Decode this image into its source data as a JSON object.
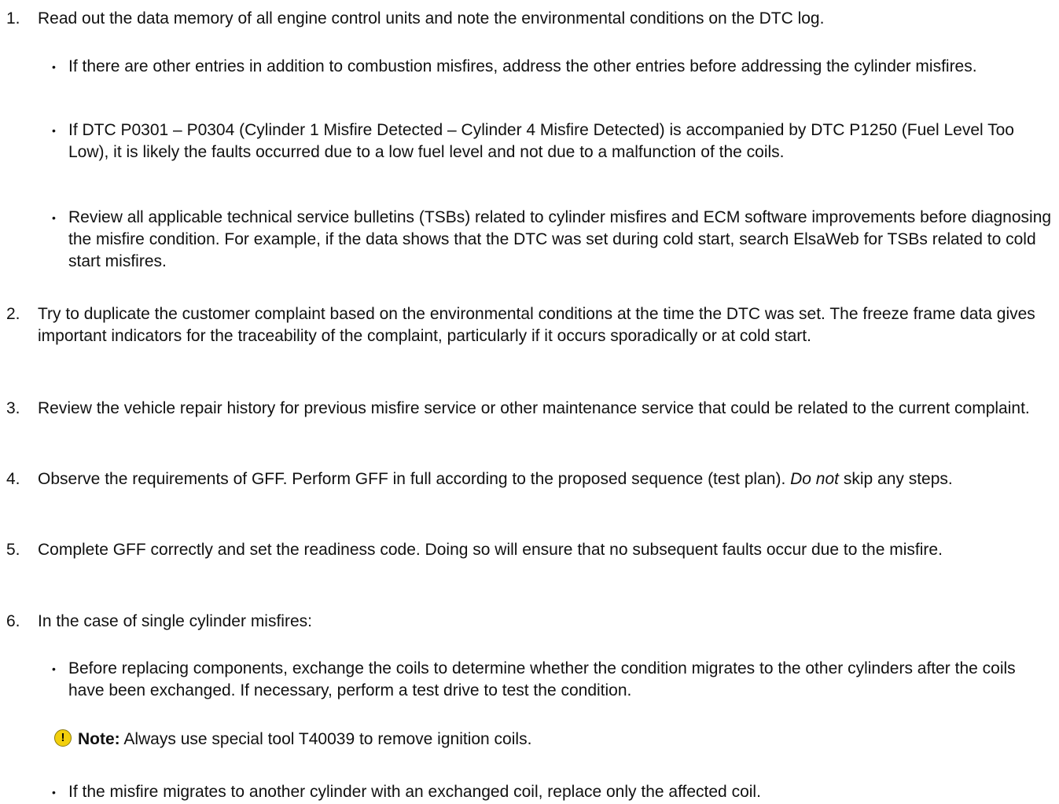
{
  "steps": [
    {
      "num": "1.",
      "text": "Read out the data memory of all engine control units and note the environmental conditions on the DTC log."
    },
    {
      "num": "2.",
      "text": "Try to duplicate the customer complaint based on the environmental conditions at the time the DTC was set. The freeze frame data gives important indicators for the traceability of the complaint, particularly if it occurs sporadically or at cold start."
    },
    {
      "num": "3.",
      "text": "Review the vehicle repair history for previous misfire service or other maintenance service that could be related to the current complaint."
    },
    {
      "num": "4.",
      "text_before": "Observe the requirements of GFF. Perform GFF in full according to the proposed sequence (test plan). ",
      "text_italic": "Do not",
      "text_after": " skip any steps."
    },
    {
      "num": "5.",
      "text": "Complete GFF correctly and set the readiness code. Doing so will ensure that no subsequent faults occur due to the misfire."
    },
    {
      "num": "6.",
      "text": "In the case of single cylinder misfires:"
    }
  ],
  "bullets_step1": [
    "If there are other entries in addition to combustion misfires, address the other entries before addressing the cylinder misfires.",
    "If DTC P0301 – P0304 (Cylinder 1 Misfire Detected – Cylinder 4 Misfire Detected) is accompanied by DTC P1250 (Fuel Level Too Low), it is likely the faults occurred due to a low fuel level and not due to a malfunction of the coils.",
    "Review all applicable technical service bulletins (TSBs) related to cylinder misfires and ECM software improvements before diagnosing the misfire condition. For example, if the data shows that the DTC was set during cold start, search ElsaWeb for TSBs related to cold start misfires."
  ],
  "bullets_step6": [
    "Before replacing components, exchange the coils to determine whether the condition migrates to the other cylinders after the coils have been exchanged. If necessary, perform a test drive to test the condition.",
    "If the misfire migrates to another cylinder with an exchanged coil, replace only the affected coil."
  ],
  "bullet_glyph": "•",
  "note": {
    "icon": "warning-icon",
    "icon_glyph": "!",
    "icon_color": "#f2cf0c",
    "label": "Note:",
    "text": " Always use special tool T40039 to remove ignition coils."
  }
}
